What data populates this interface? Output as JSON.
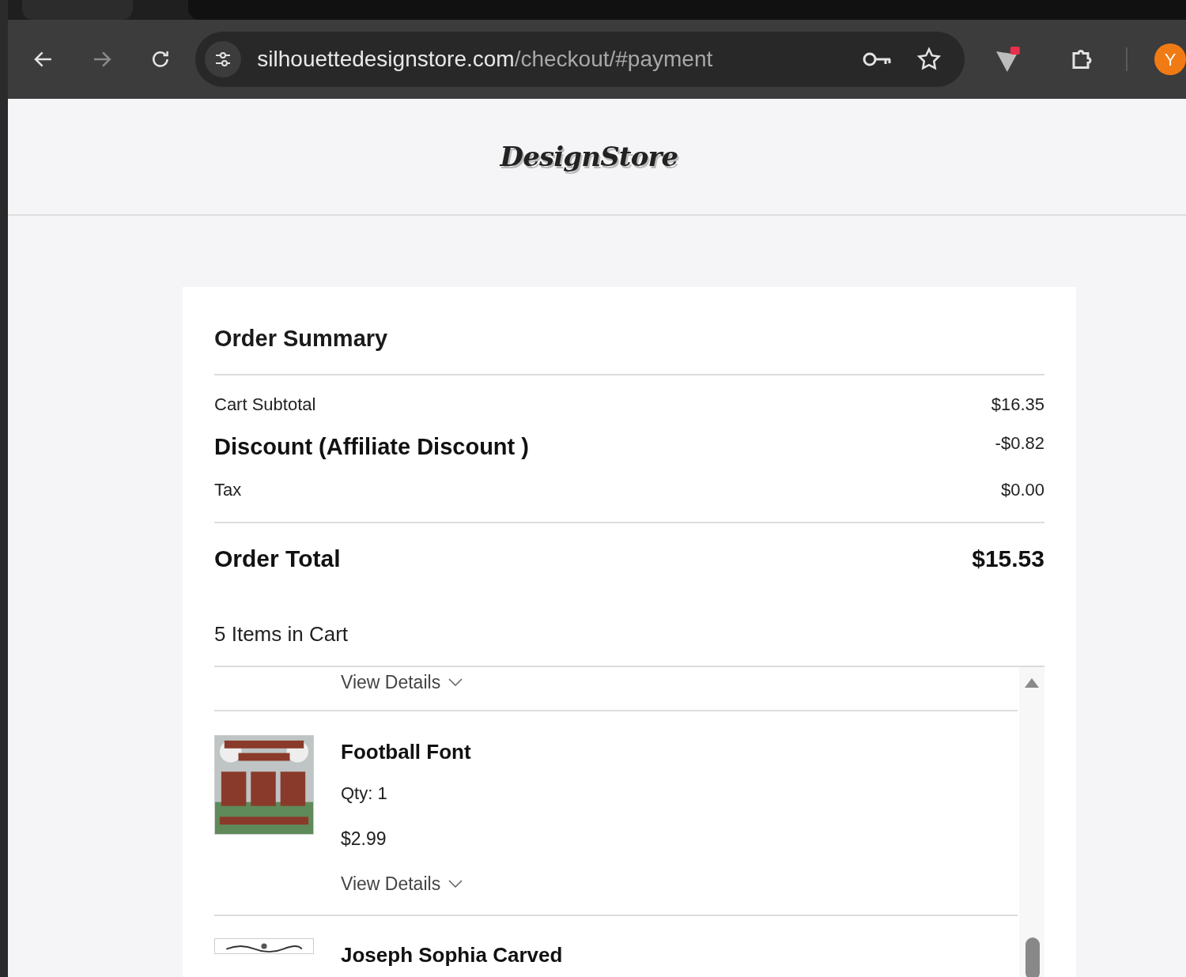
{
  "browser": {
    "url_host": "silhouettedesignstore.com",
    "url_path": "/checkout/#payment",
    "avatar_letter": "Y",
    "forward_disabled": true
  },
  "header": {
    "logo": "DesignStore"
  },
  "summary": {
    "title": "Order Summary",
    "rows": [
      {
        "label": "Cart Subtotal",
        "value": "$16.35",
        "kind": "plain"
      },
      {
        "label": "Discount (Affiliate Discount )",
        "value": "-$0.82",
        "kind": "emphasis"
      },
      {
        "label": "Tax",
        "value": "$0.00",
        "kind": "plain"
      }
    ],
    "total": {
      "label": "Order Total",
      "value": "$15.53"
    },
    "cart_count": "5 Items in Cart",
    "items": [
      {
        "details_label": "View Details"
      },
      {
        "name": "Football Font",
        "qty": "Qty: 1",
        "price": "$2.99",
        "details_label": "View Details"
      },
      {
        "name": "Joseph Sophia Carved"
      }
    ]
  }
}
